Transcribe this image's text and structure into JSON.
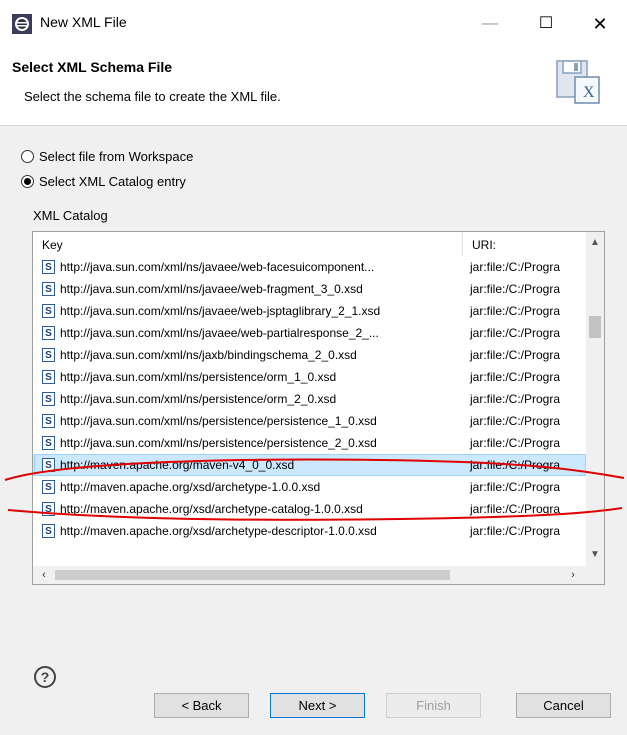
{
  "window": {
    "title": "New XML File",
    "minimize": "—",
    "maximize": "☐",
    "close": "✕"
  },
  "header": {
    "title": "Select XML Schema File",
    "description": "Select the schema file to create the XML file."
  },
  "options": {
    "workspace": "Select file from Workspace",
    "catalog": "Select XML Catalog entry",
    "selected": "catalog"
  },
  "catalog": {
    "label": "XML Catalog",
    "columns": {
      "key": "Key",
      "uri": "URI:"
    },
    "rows": [
      {
        "key": "http://java.sun.com/xml/ns/javaee/web-facesuicomponent...",
        "uri": "jar:file:/C:/Progra"
      },
      {
        "key": "http://java.sun.com/xml/ns/javaee/web-fragment_3_0.xsd",
        "uri": "jar:file:/C:/Progra"
      },
      {
        "key": "http://java.sun.com/xml/ns/javaee/web-jsptaglibrary_2_1.xsd",
        "uri": "jar:file:/C:/Progra"
      },
      {
        "key": "http://java.sun.com/xml/ns/javaee/web-partialresponse_2_...",
        "uri": "jar:file:/C:/Progra"
      },
      {
        "key": "http://java.sun.com/xml/ns/jaxb/bindingschema_2_0.xsd",
        "uri": "jar:file:/C:/Progra"
      },
      {
        "key": "http://java.sun.com/xml/ns/persistence/orm_1_0.xsd",
        "uri": "jar:file:/C:/Progra"
      },
      {
        "key": "http://java.sun.com/xml/ns/persistence/orm_2_0.xsd",
        "uri": "jar:file:/C:/Progra"
      },
      {
        "key": "http://java.sun.com/xml/ns/persistence/persistence_1_0.xsd",
        "uri": "jar:file:/C:/Progra"
      },
      {
        "key": "http://java.sun.com/xml/ns/persistence/persistence_2_0.xsd",
        "uri": "jar:file:/C:/Progra"
      },
      {
        "key": "http://maven.apache.org/maven-v4_0_0.xsd",
        "uri": "jar:file:/C:/Progra",
        "selected": true
      },
      {
        "key": "http://maven.apache.org/xsd/archetype-1.0.0.xsd",
        "uri": "jar:file:/C:/Progra"
      },
      {
        "key": "http://maven.apache.org/xsd/archetype-catalog-1.0.0.xsd",
        "uri": "jar:file:/C:/Progra"
      },
      {
        "key": "http://maven.apache.org/xsd/archetype-descriptor-1.0.0.xsd",
        "uri": "jar:file:/C:/Progra"
      }
    ],
    "file_icon_letter": "S"
  },
  "buttons": {
    "back": "< Back",
    "next": "Next >",
    "finish": "Finish",
    "cancel": "Cancel",
    "help": "?"
  },
  "colors": {
    "selection": "#cce8ff",
    "annotation": "#e00000"
  }
}
